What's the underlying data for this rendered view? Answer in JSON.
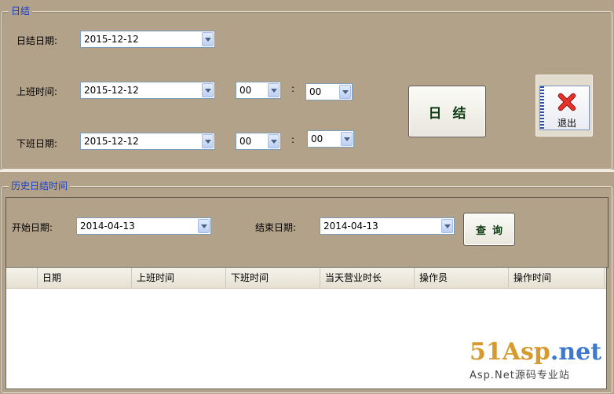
{
  "daily_close": {
    "title": "日结",
    "date_label": "日结日期:",
    "date_value": "2015-12-12",
    "on_label": "上班时间:",
    "on_date": "2015-12-12",
    "on_hour": "00",
    "on_minute": "00",
    "off_label": "下班日期:",
    "off_date": "2015-12-12",
    "off_hour": "00",
    "off_minute": "00",
    "colon": ":",
    "close_button": "日结",
    "exit_button": "退出"
  },
  "history": {
    "title": "历史日结时间",
    "start_label": "开始日期:",
    "start_value": "2014-04-13",
    "end_label": "结束日期:",
    "end_value": "2014-04-13",
    "query_button": "查询",
    "columns": [
      "日期",
      "上班时间",
      "下班时间",
      "当天营业时长",
      "操作员",
      "操作时间"
    ]
  },
  "watermark": {
    "brand_a": "51Asp",
    "brand_b": ".net",
    "tagline": "Asp.Net源码专业站"
  },
  "colors": {
    "background": "#b3a28a",
    "group_title": "#1a3fc4",
    "exit_icon": "#d8261d"
  },
  "icons": {
    "exit": "close-x-icon",
    "combo": "chevron-down-icon"
  }
}
